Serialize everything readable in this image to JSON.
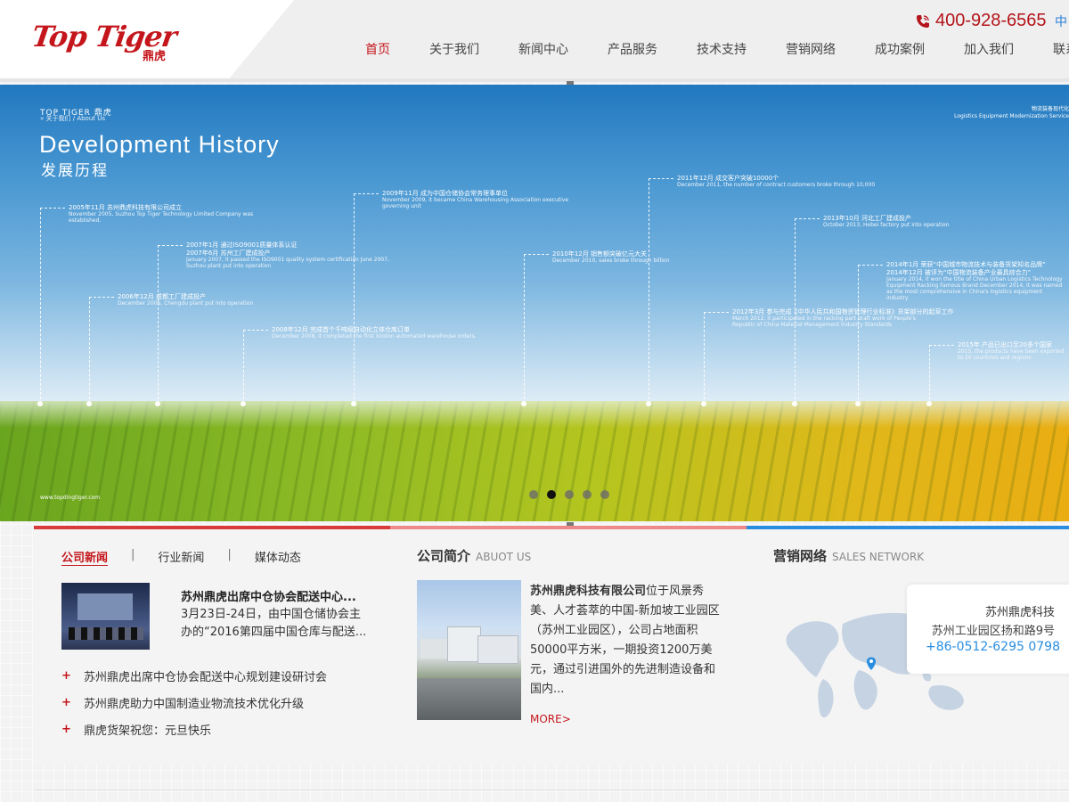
{
  "header": {
    "logo_main": "Top Tiger",
    "logo_sub": "鼎虎",
    "phone": "400-928-6565",
    "lang": "中",
    "nav": [
      "首页",
      "关于我们",
      "新闻中心",
      "产品服务",
      "技术支持",
      "营销网络",
      "成功案例",
      "加入我们",
      "联系"
    ],
    "active_index": 0
  },
  "banner": {
    "brand": "TOP TIGER 鼎虎",
    "crumb": "» 关于我们 / About Us",
    "title_en": "Development History",
    "title_cn": "发展历程",
    "right_cn": "物流装备现代化",
    "right_en": "Logistics Equipment Modernization Service",
    "url": "www.topdingtiger.com",
    "milestones": [
      {
        "title": "2005年11月  苏州鼎虎科技有限公司成立",
        "desc": "November 2005, Suzhou Top Tiger Technology Limited Company was established."
      },
      {
        "title": "2006年12月  成都工厂建成投产",
        "desc": "December 2006, Chengdu plant put into operation"
      },
      {
        "title": "2007年1月  通过ISO9001质量体系认证\n2007年6月  苏州工厂建成投产",
        "desc": "January 2007, it passed the ISO9001 quality system certification June 2007, Suzhou plant put into operation"
      },
      {
        "title": "2008年12月  完成首个千吨级自动化立体仓库订单",
        "desc": "December 2008, it completed the first kiloton automated warehouse orders."
      },
      {
        "title": "2009年11月  成为中国仓储协会常务理事单位",
        "desc": "November 2009, it became China Warehousing Association executive governing unit"
      },
      {
        "title": "2010年12月  销售额突破亿元大关",
        "desc": "December 2010, sales broke through billion"
      },
      {
        "title": "2011年12月  成交客户突破10000个",
        "desc": "December 2011, the number of contract customers broke through 10,000"
      },
      {
        "title": "2012年3月  参与完成《中华人民共和国物资管理行业标准》货架部分的起草工作",
        "desc": "March 2012, it participated in the racking part draft work of People's Republic of China Material Management Industry Standards"
      },
      {
        "title": "2013年10月  河北工厂建成投产",
        "desc": "October 2013, Hebei factory put into operation"
      },
      {
        "title": "2014年1月  荣获“中国城市物流技术与装备货架知名品牌”\n2014年12月  被评为“中国物流装备产业最具综合力”",
        "desc": "January 2014, it won the title of China Urban Logistics Technology Equipment Racking Famous Brand December 2014, it was named as the most comprehensive in China's logistics equipment industry"
      },
      {
        "title": "2015年  产品已出口至20多个国家",
        "desc": "2015, the products have been exported to 20 countries and regions"
      }
    ],
    "slide_count": 5,
    "active_slide": 1
  },
  "news": {
    "tabs": [
      "公司新闻",
      "行业新闻",
      "媒体动态"
    ],
    "separator": "|",
    "active_tab": 0,
    "featured_title": "苏州鼎虎出席中仓协会配送中心...",
    "featured_summary": "3月23日-24日，由中国仓储协会主办的“2016第四届中国仓库与配送...",
    "bullet": "+",
    "items": [
      "苏州鼎虎出席中仓协会配送中心规划建设研讨会",
      "苏州鼎虎助力中国制造业物流技术优化升级",
      "鼎虎货架祝您：元旦快乐"
    ]
  },
  "about": {
    "title": "公司简介",
    "title_en": "ABUOT US",
    "company": "苏州鼎虎科技有限公司",
    "text": "位于风景秀美、人才荟萃的中国-新加坡工业园区（苏州工业园区），公司占地面积50000平方米，一期投资1200万美元，通过引进国外的先进制造设备和国内...",
    "more": "MORE>"
  },
  "network": {
    "title": "营销网络",
    "title_en": "SALES NETWORK",
    "name": "苏州鼎虎科技",
    "address": "苏州工业园区扬和路9号",
    "phone": "+86-0512-6295 0798"
  },
  "colors": {
    "brand_red": "#c4161c",
    "link_blue": "#2a8ee0"
  }
}
